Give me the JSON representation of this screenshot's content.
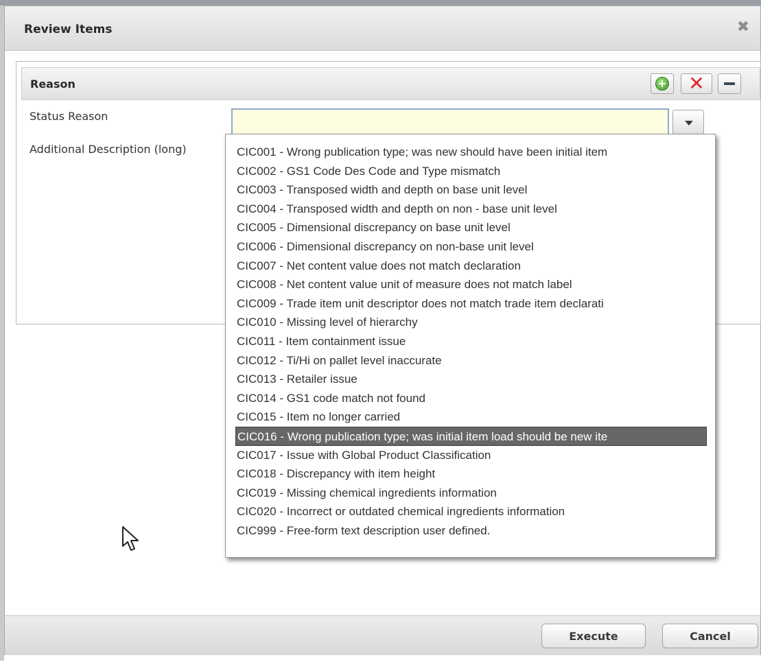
{
  "dialog": {
    "title": "Review Items",
    "close_icon": "close-icon"
  },
  "panel": {
    "title": "Reason",
    "tools": {
      "add_icon": "plus-circle-icon",
      "delete_icon": "red-x-icon",
      "minimize_icon": "minus-icon"
    }
  },
  "form": {
    "status_reason_label": "Status Reason",
    "status_reason_value": "",
    "additional_description_label": "Additional Description (long)"
  },
  "dropdown": {
    "selected_index": 15,
    "options": [
      "CIC001 - Wrong publication type; was new should have been initial item",
      "CIC002 - GS1 Code Des Code and Type mismatch",
      "CIC003 - Transposed width and depth on base unit level",
      "CIC004 - Transposed width and depth on non - base unit level",
      "CIC005 - Dimensional discrepancy on base unit level",
      "CIC006 - Dimensional discrepancy on non-base unit level",
      "CIC007 - Net content value does not match declaration",
      "CIC008 - Net content value unit of measure does not match label",
      "CIC009 - Trade item unit descriptor does not match trade item declarati",
      "CIC010 - Missing level of hierarchy",
      "CIC011 - Item containment issue",
      "CIC012 - Ti/Hi on pallet level inaccurate",
      "CIC013 - Retailer issue",
      "CIC014 - GS1 code match not found",
      "CIC015 - Item no longer carried",
      "CIC016 - Wrong publication type; was initial item load should be new ite",
      "CIC017 - Issue with Global Product Classification",
      "CIC018 - Discrepancy with item height",
      "CIC019 - Missing chemical ingredients information",
      "CIC020 - Incorrect or outdated chemical ingredients information",
      "CIC999 - Free-form text description user defined."
    ]
  },
  "footer": {
    "execute_label": "Execute",
    "cancel_label": "Cancel"
  },
  "colors": {
    "input_background": "#fffde0",
    "selected_option": "#676767",
    "delete_red": "#e0282c",
    "add_green": "#3e9a28"
  }
}
